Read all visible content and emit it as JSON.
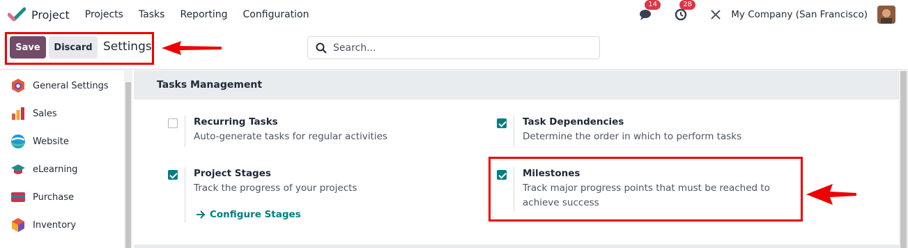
{
  "header": {
    "app_name": "Project",
    "menu": [
      "Projects",
      "Tasks",
      "Reporting",
      "Configuration"
    ],
    "messages_count": "14",
    "activities_count": "28",
    "company": "My Company (San Francisco)"
  },
  "control": {
    "save_label": "Save",
    "discard_label": "Discard",
    "title": "Settings",
    "search_placeholder": "Search..."
  },
  "sidebar": {
    "items": [
      "General Settings",
      "Sales",
      "Website",
      "eLearning",
      "Purchase",
      "Inventory"
    ]
  },
  "section": {
    "title": "Tasks Management",
    "settings": [
      {
        "title": "Recurring Tasks",
        "description": "Auto-generate tasks for regular activities",
        "checked": false
      },
      {
        "title": "Task Dependencies",
        "description": "Determine the order in which to perform tasks",
        "checked": true
      },
      {
        "title": "Project Stages",
        "description": "Track the progress of your projects",
        "checked": true,
        "link": "Configure Stages"
      },
      {
        "title": "Milestones",
        "description": "Track major progress points that must be reached to achieve success",
        "checked": true
      }
    ]
  },
  "colors": {
    "primary": "#714b67",
    "accent": "#017e84",
    "annotation": "#e00000"
  }
}
